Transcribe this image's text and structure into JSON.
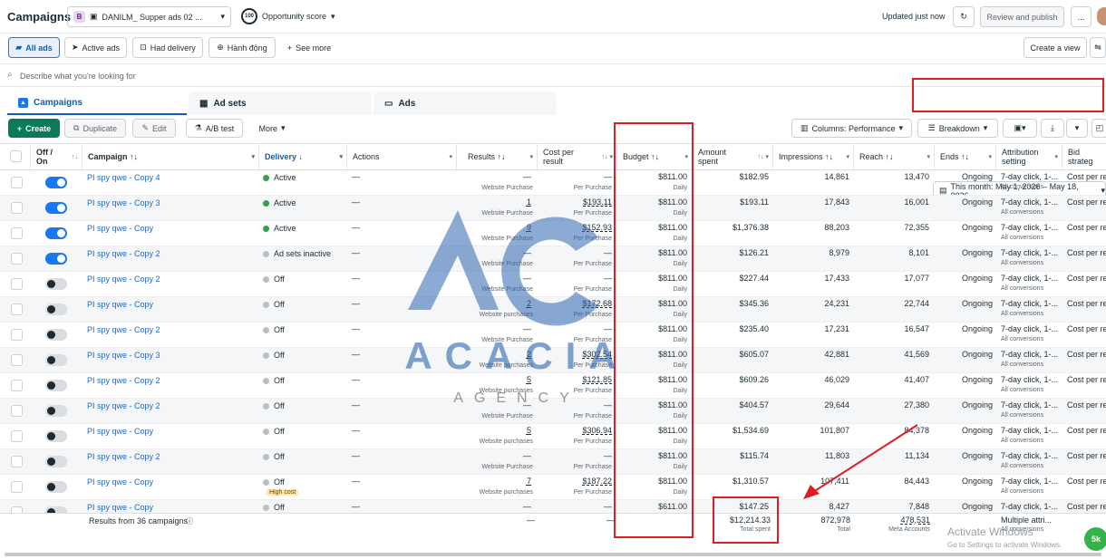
{
  "topbar": {
    "title": "Campaigns",
    "account_badge": "B",
    "account_name": "DANILM_ Supper ads 02 ...",
    "opportunity_score": "100",
    "opportunity_label": "Opportunity score",
    "updated": "Updated just now",
    "review_publish": "Review and publish",
    "more": "..."
  },
  "filters": {
    "items": [
      "All ads",
      "Active ads",
      "Had delivery",
      "Hành động"
    ],
    "see_more": "See more",
    "create_view": "Create a view"
  },
  "search": {
    "placeholder": "Describe what you're looking for"
  },
  "tabs": {
    "campaigns": "Campaigns",
    "adsets": "Ad sets",
    "ads": "Ads",
    "date_range": "This month: May 1, 2026 – May 18, 2026"
  },
  "toolbar": {
    "create": "Create",
    "duplicate": "Duplicate",
    "edit": "Edit",
    "abtest": "A/B test",
    "more": "More",
    "columns": "Columns: Performance",
    "breakdown": "Breakdown"
  },
  "columns": {
    "offon": "Off / On",
    "campaign": "Campaign",
    "delivery": "Delivery",
    "actions": "Actions",
    "results": "Results",
    "cost_per_result": "Cost per result",
    "budget": "Budget",
    "amount_spent": "Amount spent",
    "impressions": "Impressions",
    "reach": "Reach",
    "ends": "Ends",
    "attribution": "Attribution setting",
    "bid": "Bid strateg"
  },
  "rows": [
    {
      "on": true,
      "name": "PI spy qwe - Copy 4",
      "delivery": "Active",
      "status": "active",
      "results": "—",
      "results_sub": "Website Purchase",
      "cpr": "—",
      "cpr_sub": "Per Purchase",
      "budget": "$811.00",
      "spent": "$182.95",
      "impressions": "14,861",
      "reach": "13,470"
    },
    {
      "on": true,
      "name": "PI spy qwe - Copy 3",
      "delivery": "Active",
      "status": "active",
      "results": "1",
      "results_sub": "Website Purchase",
      "cpr": "$193.11",
      "cpr_sub": "Per Purchase",
      "budget": "$811.00",
      "spent": "$193.11",
      "impressions": "17,843",
      "reach": "16,001"
    },
    {
      "on": true,
      "name": "PI spy qwe - Copy",
      "delivery": "Active",
      "status": "active",
      "results": "9",
      "results_sub": "Website Purchase",
      "cpr": "$152.93",
      "cpr_sub": "Per Purchase",
      "budget": "$811.00",
      "spent": "$1,376.38",
      "impressions": "88,203",
      "reach": "72,355"
    },
    {
      "on": true,
      "name": "PI spy qwe - Copy 2",
      "delivery": "Ad sets inactive",
      "status": "inactive",
      "results": "—",
      "results_sub": "Website Purchase",
      "cpr": "—",
      "cpr_sub": "Per Purchase",
      "budget": "$811.00",
      "spent": "$126.21",
      "impressions": "8,979",
      "reach": "8,101"
    },
    {
      "on": false,
      "name": "PI spy qwe - Copy 2",
      "delivery": "Off",
      "status": "off",
      "results": "—",
      "results_sub": "Website Purchase",
      "cpr": "—",
      "cpr_sub": "Per Purchase",
      "budget": "$811.00",
      "spent": "$227.44",
      "impressions": "17,433",
      "reach": "17,077"
    },
    {
      "on": false,
      "name": "PI spy qwe - Copy",
      "delivery": "Off",
      "status": "off",
      "results": "2",
      "results_sub": "Website purchases",
      "cpr": "$172.68",
      "cpr_sub": "Per Purchase",
      "budget": "$811.00",
      "spent": "$345.36",
      "impressions": "24,231",
      "reach": "22,744"
    },
    {
      "on": false,
      "name": "PI spy qwe - Copy 2",
      "delivery": "Off",
      "status": "off",
      "results": "—",
      "results_sub": "Website Purchase",
      "cpr": "—",
      "cpr_sub": "Per Purchase",
      "budget": "$811.00",
      "spent": "$235.40",
      "impressions": "17,231",
      "reach": "16,547"
    },
    {
      "on": false,
      "name": "PI spy qwe - Copy 3",
      "delivery": "Off",
      "status": "off",
      "results": "2",
      "results_sub": "Website purchases",
      "cpr": "$302.54",
      "cpr_sub": "Per Purchase",
      "budget": "$811.00",
      "spent": "$605.07",
      "impressions": "42,881",
      "reach": "41,569"
    },
    {
      "on": false,
      "name": "PI spy qwe - Copy 2",
      "delivery": "Off",
      "status": "off",
      "results": "5",
      "results_sub": "Website purchases",
      "cpr": "$121.85",
      "cpr_sub": "Per Purchase",
      "budget": "$811.00",
      "spent": "$609.26",
      "impressions": "46,029",
      "reach": "41,407"
    },
    {
      "on": false,
      "name": "PI spy qwe - Copy 2",
      "delivery": "Off",
      "status": "off",
      "results": "—",
      "results_sub": "Website Purchase",
      "cpr": "—",
      "cpr_sub": "Per Purchase",
      "budget": "$811.00",
      "spent": "$404.57",
      "impressions": "29,644",
      "reach": "27,380"
    },
    {
      "on": false,
      "name": "PI spy qwe - Copy",
      "delivery": "Off",
      "status": "off",
      "results": "5",
      "results_sub": "Website purchases",
      "cpr": "$306.94",
      "cpr_sub": "Per Purchase",
      "budget": "$811.00",
      "spent": "$1,534.69",
      "impressions": "101,807",
      "reach": "84,378"
    },
    {
      "on": false,
      "name": "PI spy qwe - Copy 2",
      "delivery": "Off",
      "status": "off",
      "results": "—",
      "results_sub": "Website Purchase",
      "cpr": "—",
      "cpr_sub": "Per Purchase",
      "budget": "$811.00",
      "spent": "$115.74",
      "impressions": "11,803",
      "reach": "11,134"
    },
    {
      "on": false,
      "name": "PI spy qwe - Copy",
      "delivery": "Off",
      "status": "off",
      "badge": "High cost",
      "results": "7",
      "results_sub": "Website purchases",
      "cpr": "$187.22",
      "cpr_sub": "Per Purchase",
      "budget": "$811.00",
      "spent": "$1,310.57",
      "impressions": "107,411",
      "reach": "84,443"
    },
    {
      "on": false,
      "name": "PI spy qwe - Copy",
      "delivery": "Off",
      "status": "off",
      "results": "—",
      "results_sub": "",
      "cpr": "—",
      "cpr_sub": "",
      "budget": "$611.00",
      "spent": "$147.25",
      "impressions": "8,427",
      "reach": "7,848"
    }
  ],
  "row_common": {
    "budget_sub": "Daily",
    "ends": "Ongoing",
    "attribution": "7-day click, 1-...",
    "attribution_sub": "All conversions",
    "bid": "Cost per re",
    "actions": "—"
  },
  "footer": {
    "label": "Results from 36 campaigns",
    "results": "—",
    "cpr": "—",
    "spent": "$12,214.33",
    "spent_sub": "Total spent",
    "impressions": "872,978",
    "impressions_sub": "Total",
    "reach": "478,531",
    "reach_sub": "Meta Accounts",
    "attribution": "Multiple attri...",
    "attribution_sub": "All conversions"
  },
  "watermark": {
    "big": "AC",
    "word": "ACACIA",
    "sub": "AGENCY"
  },
  "windows": {
    "line1": "Activate Windows",
    "line2": "Go to Settings to activate Windows."
  },
  "help": "5k",
  "colors": {
    "accent": "#1877f2",
    "create": "#0a7a5a",
    "annotation": "#e01b24",
    "active_dot": "#31a24c",
    "link": "#1d65c1"
  }
}
